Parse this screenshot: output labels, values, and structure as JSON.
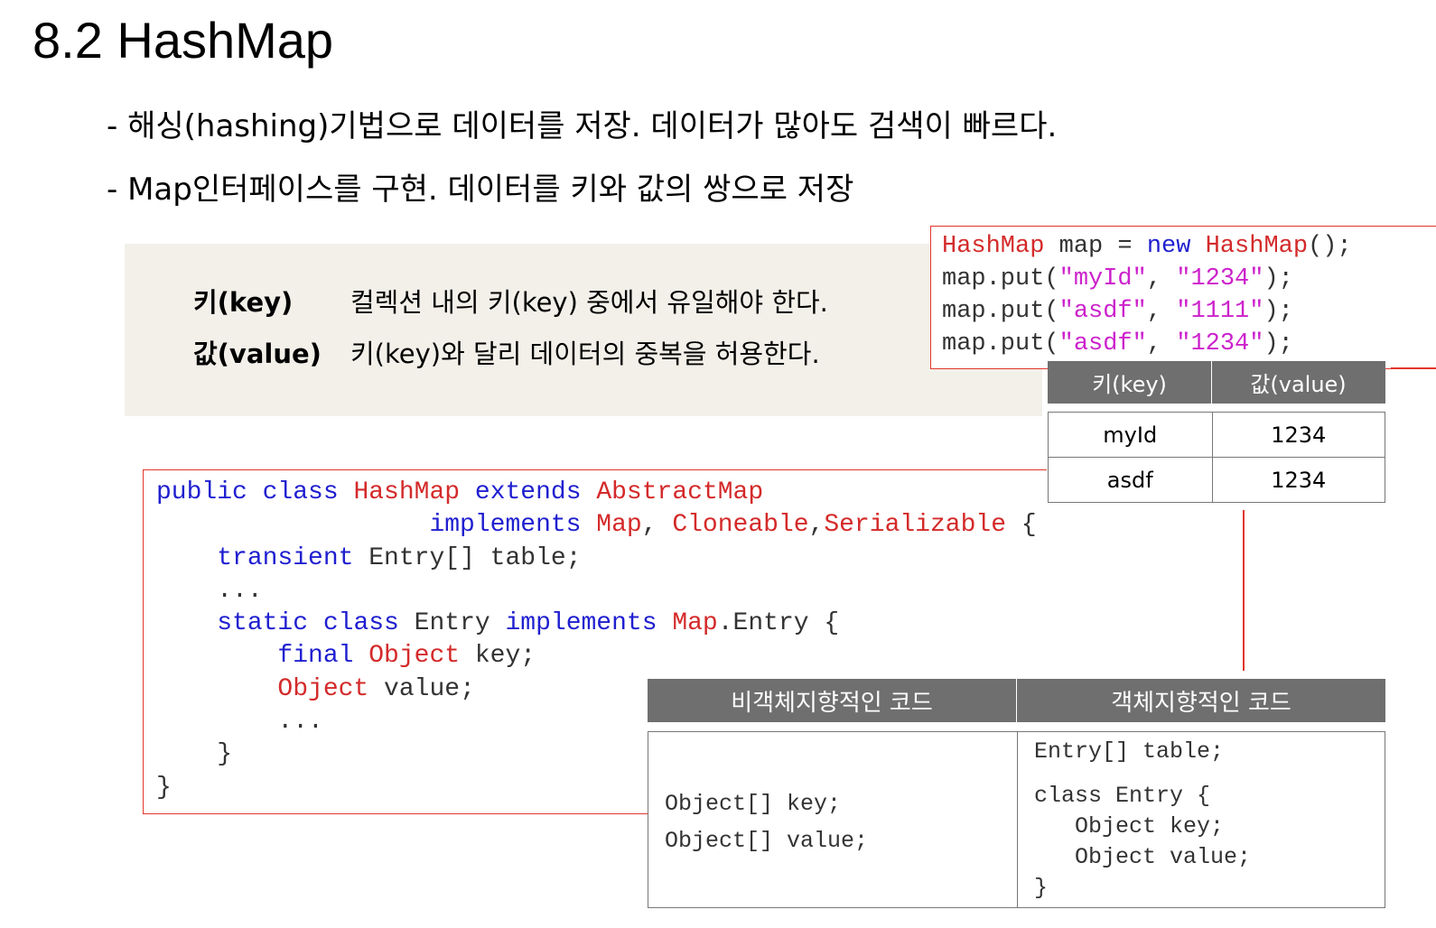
{
  "title": "8.2 HashMap",
  "bullets": [
    "- 해싱(hashing)기법으로 데이터를 저장. 데이터가 많아도 검색이 빠르다.",
    "- Map인터페이스를 구현. 데이터를 키와 값의 쌍으로 저장"
  ],
  "definitions": [
    {
      "term": "키(key)",
      "desc": "컬렉션 내의 키(key) 중에서 유일해야 한다."
    },
    {
      "term": "값(value)",
      "desc": "키(key)와 달리 데이터의 중복을 허용한다."
    }
  ],
  "colors": {
    "keyword": "#1f1fd0",
    "type": "#d42a2a",
    "string": "#cc22cc",
    "border": "#e3352a",
    "header_bg": "#6f6f6f",
    "def_bg": "#f2f0e9"
  },
  "put_code": {
    "line1": {
      "a": "HashMap",
      "b": " map = ",
      "c": "new",
      "d": " ",
      "e": "HashMap",
      "f": "();"
    },
    "line2": {
      "a": "map.put(",
      "b": "\"myId\"",
      "c": ", ",
      "d": "\"1234\"",
      "e": ");"
    },
    "line3": {
      "a": "map.put(",
      "b": "\"asdf\"",
      "c": ", ",
      "d": "\"1111\"",
      "e": ");"
    },
    "line4": {
      "a": "map.put(",
      "b": "\"asdf\"",
      "c": ", ",
      "d": "\"1234\"",
      "e": ");"
    }
  },
  "kv_table": {
    "headers": [
      "키(key)",
      "값(value)"
    ],
    "rows": [
      [
        "myId",
        "1234"
      ],
      [
        "asdf",
        "1234"
      ]
    ]
  },
  "class_code": {
    "l1": {
      "a": "public class",
      "b": " ",
      "c": "HashMap",
      "d": " ",
      "e": "extends",
      "f": " ",
      "g": "AbstractMap"
    },
    "l2": {
      "a": "                  ",
      "b": "implements",
      "c": " ",
      "d": "Map",
      "e": ", ",
      "f": "Cloneable",
      "g": ",",
      "h": "Serializable",
      "i": " {"
    },
    "l3": {
      "a": "    ",
      "b": "transient",
      "c": " Entry[] table;"
    },
    "l4": "    ...",
    "l5": {
      "a": "    ",
      "b": "static class",
      "c": " Entry ",
      "d": "implements",
      "e": " ",
      "f": "Map",
      "g": ".Entry {"
    },
    "l6": {
      "a": "        ",
      "b": "final",
      "c": " ",
      "d": "Object",
      "e": " key;"
    },
    "l7": {
      "a": "        ",
      "b": "Object",
      "c": " value;"
    },
    "l8": "        ...",
    "l9": "    }",
    "l10": "}"
  },
  "compare_table": {
    "headers": [
      "비객체지향적인 코드",
      "객체지향적인 코드"
    ],
    "left_code": "Object[] key;\nObject[] value;",
    "right_code_1": "Entry[] table;",
    "right_code_2": "class Entry {\n   Object key;\n   Object value;\n}"
  }
}
